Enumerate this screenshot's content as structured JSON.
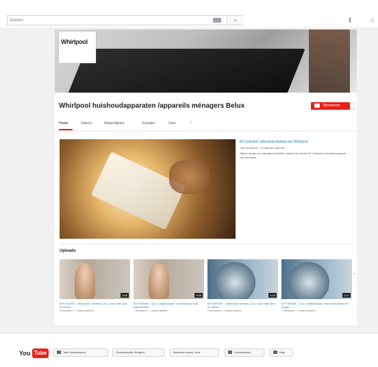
{
  "search": {
    "placeholder": "Zoeken"
  },
  "channel": {
    "logo": "Whirlpool",
    "title": "Whirlpool huishoudapparaten /appareils ménagers Belux",
    "subscribe_label": "Abonneren"
  },
  "tabs": [
    "Home",
    "Video's",
    "Afspeellijsten",
    "Kanalen",
    "Over"
  ],
  "featured": {
    "title": "W Collection inductiekookplaat van Whirlpool",
    "meta": "156 weergaven • 3 maanden geleden",
    "description": "Stijlvol design en volledige flexibiliteit: ontdek de nieuwe W Collection inductiekookplaat van Whirlpool."
  },
  "uploads": {
    "label": "Uploads",
    "videos": [
      {
        "title": "6TH SENSE - Ultrahoher Vorsteel 3-in-1 voor natte was en stoom...",
        "meta": "9 weergaven • 1 maand geleden",
        "duration": "0:58",
        "image": "woman"
      },
      {
        "title": "6TH SENSE - 3-in-1 strijkindicator van Whirlpool voor wasmachine...",
        "meta": "7 weergaven • 1 maand geleden",
        "duration": "0:58",
        "image": "woman"
      },
      {
        "title": "6TH SENSE - Ultrahoher Vorsteel 3-in-1 voor natte was en stoom...",
        "meta": "5 weergaven • 1 maand geleden",
        "duration": "0:33",
        "image": "washer"
      },
      {
        "title": "6TH SENSE - 3-in-1 strijkindicator voor wasmachine en droger...",
        "meta": "7 weergaven • 1 maand geleden",
        "duration": "0:27",
        "image": "washer"
      }
    ]
  },
  "footer": {
    "logo_you": "You",
    "logo_tube": "Tube",
    "buttons": [
      {
        "label": "Taal: Nederlands",
        "icon": "language-icon",
        "dropdown": true
      },
      {
        "label": "Contentlocatie: België",
        "icon": "",
        "dropdown": true
      },
      {
        "label": "Beperkte modus: Uit",
        "icon": "",
        "dropdown": true
      },
      {
        "label": "Geschiedenis",
        "icon": "history-icon",
        "dropdown": false
      },
      {
        "label": "Help",
        "icon": "help-icon",
        "dropdown": false
      }
    ]
  }
}
